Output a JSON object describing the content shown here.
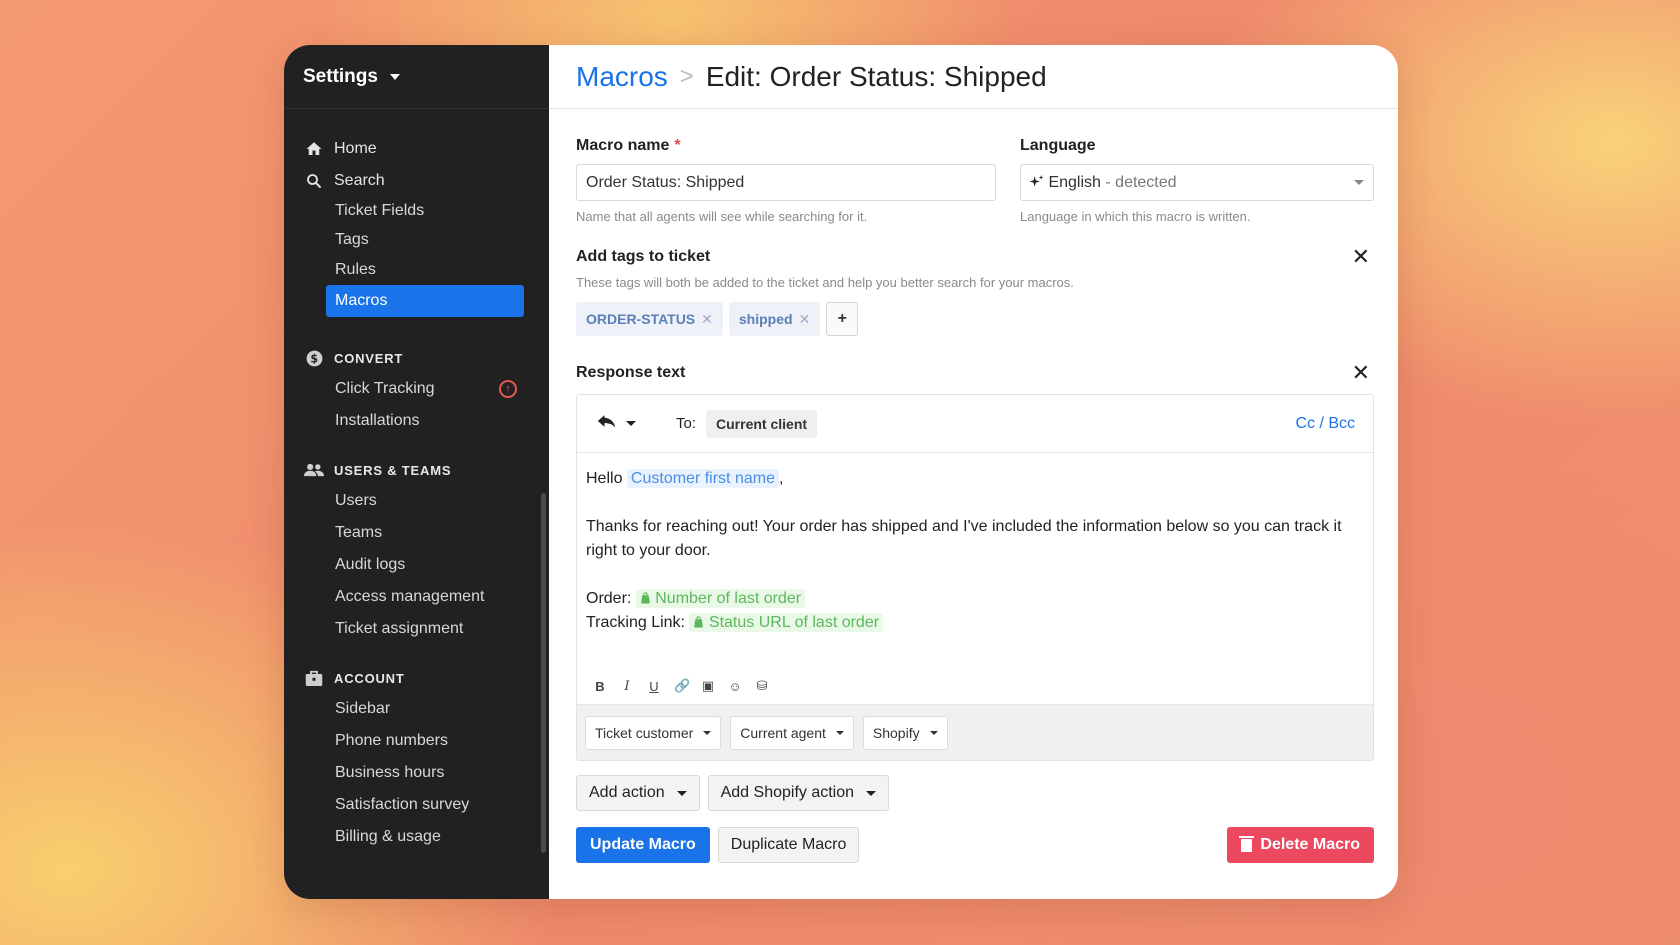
{
  "sidebar": {
    "title": "Settings",
    "top_items": [
      {
        "label": "Home",
        "icon": "home-icon"
      },
      {
        "label": "Search",
        "icon": "search-icon"
      }
    ],
    "search_sub": [
      "Ticket Fields",
      "Tags",
      "Rules"
    ],
    "active_item": "Macros",
    "convert": {
      "label": "CONVERT",
      "items": [
        "Click Tracking",
        "Installations"
      ],
      "upgrade_badge": "↑"
    },
    "users_teams": {
      "label": "USERS & TEAMS",
      "items": [
        "Users",
        "Teams",
        "Audit logs",
        "Access management",
        "Ticket assignment"
      ]
    },
    "account": {
      "label": "ACCOUNT",
      "items": [
        "Sidebar",
        "Phone numbers",
        "Business hours",
        "Satisfaction survey",
        "Billing & usage"
      ]
    }
  },
  "breadcrumb": {
    "parent": "Macros",
    "separator": ">",
    "current": "Edit: Order Status: Shipped"
  },
  "form": {
    "macro_name": {
      "label": "Macro name",
      "required_mark": "*",
      "value": "Order Status: Shipped",
      "hint": "Name that all agents will see while searching for it."
    },
    "language": {
      "label": "Language",
      "value": "English",
      "suffix": "- detected",
      "hint": "Language in which this macro is written."
    },
    "tags": {
      "label": "Add tags to ticket",
      "hint": "These tags will both be added to the ticket and help you better search for your macros.",
      "items": [
        "ORDER-STATUS",
        "shipped"
      ],
      "add_label": "+"
    },
    "response": {
      "label": "Response text",
      "to_label": "To:",
      "recipient": "Current client",
      "cc_bcc": "Cc / Bcc",
      "greeting": "Hello",
      "var_first_name": "Customer first name",
      "greeting_end": ",",
      "body": "Thanks for reaching out! Your order has shipped and I've included the information below so you can track it right to your door.",
      "order_label": "Order:",
      "var_order": "Number of last order",
      "tracking_label": "Tracking Link:",
      "var_tracking": "Status URL of last order",
      "format_tools": [
        "B",
        "I",
        "U",
        "🔗",
        "▣",
        "☺",
        "⛁"
      ],
      "variable_menus": [
        "Ticket customer",
        "Current agent",
        "Shopify"
      ]
    }
  },
  "actions": {
    "add_action": "Add action",
    "add_shopify_action": "Add Shopify action",
    "update": "Update Macro",
    "duplicate": "Duplicate Macro",
    "delete": "Delete Macro"
  },
  "colors": {
    "primary": "#1a73e8",
    "danger": "#ec4961",
    "sidebar_bg": "#212121"
  }
}
